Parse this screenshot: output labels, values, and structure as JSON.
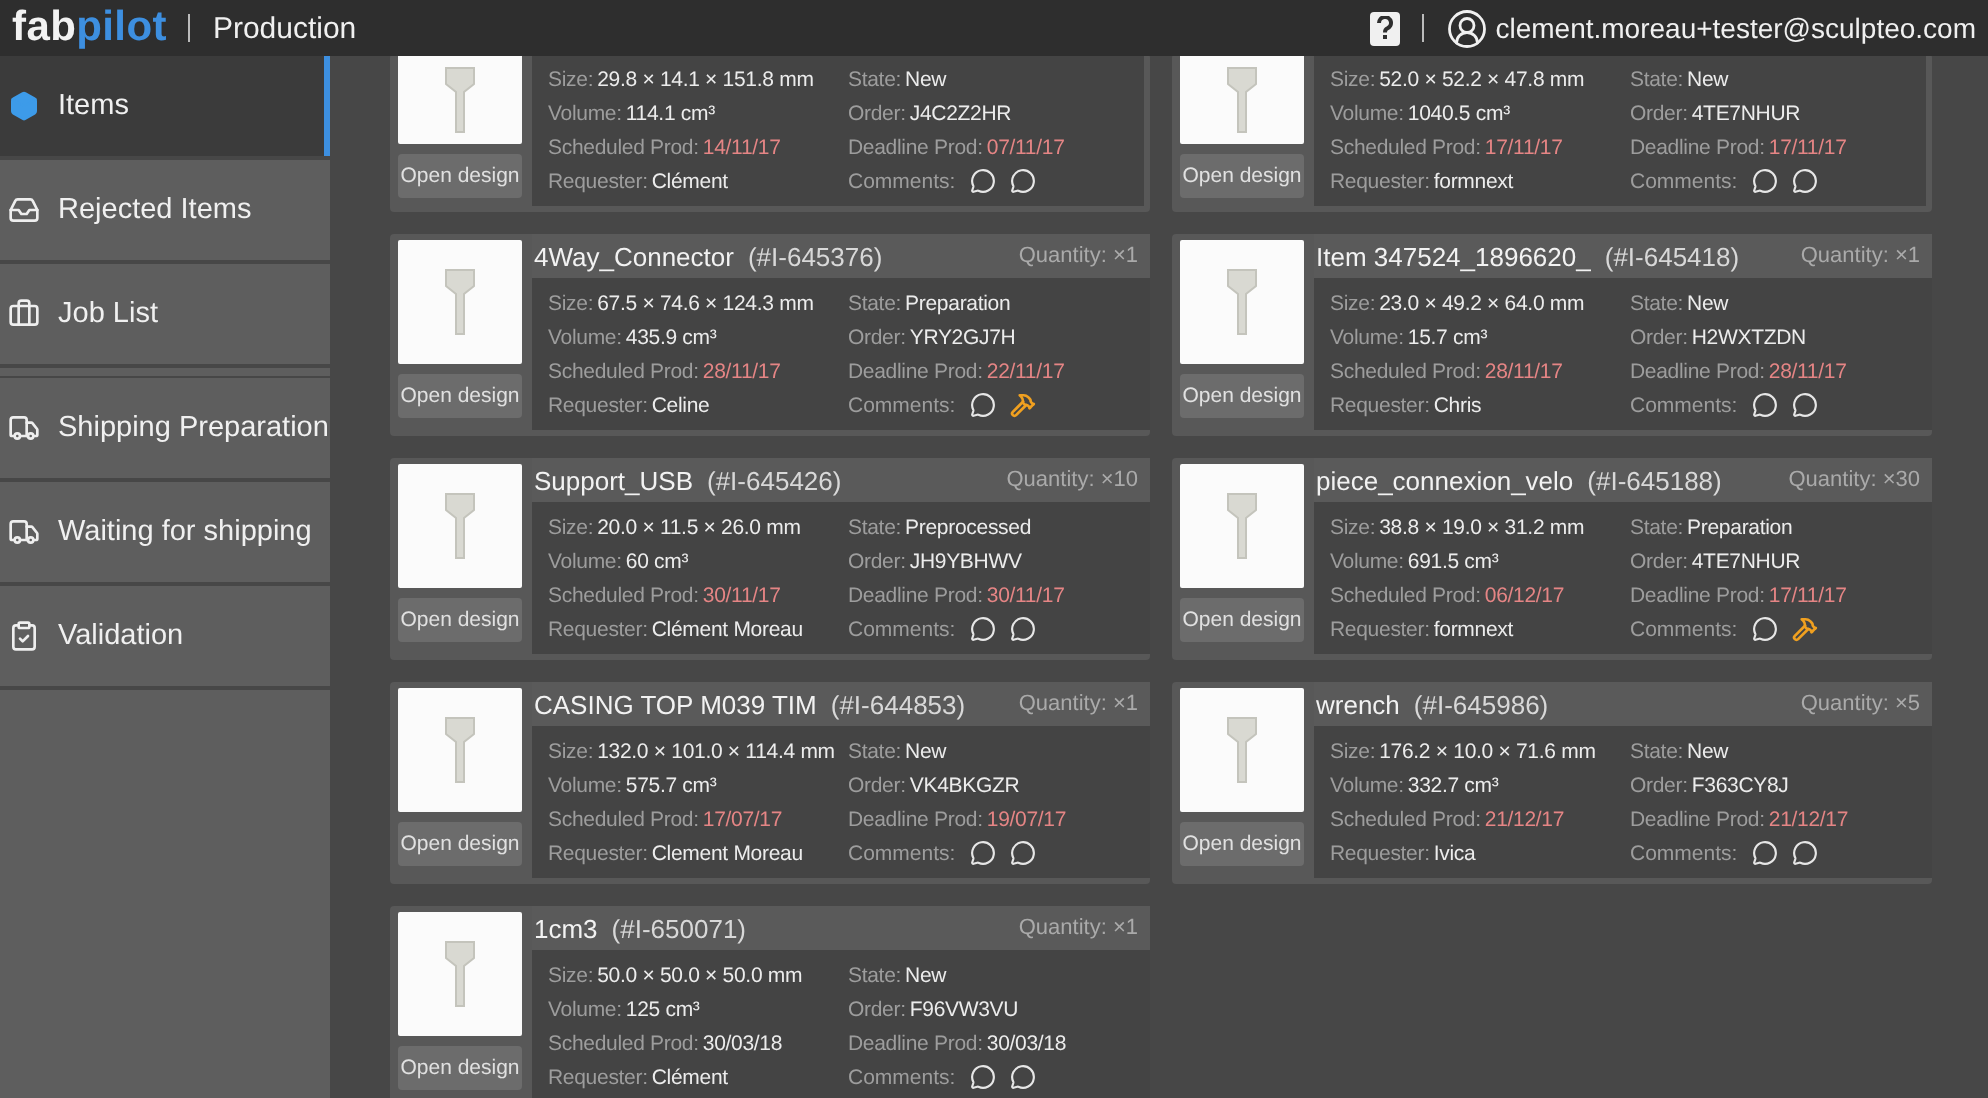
{
  "header": {
    "logo": {
      "text": "fab",
      "accent": "pilot"
    },
    "section": "Production",
    "user": "clement.moreau+tester@sculpteo.com"
  },
  "sidebar": {
    "items": [
      {
        "label": "Items",
        "selected": true
      },
      {
        "label": "Rejected Items",
        "selected": false
      },
      {
        "label": "Job List",
        "selected": false
      },
      {
        "label": "Shipping Preparation",
        "selected": false
      },
      {
        "label": "Waiting for shipping",
        "selected": false
      },
      {
        "label": "Validation",
        "selected": false
      }
    ]
  },
  "items": [
    {
      "button": "Open design",
      "details": [
        {
          "label": "Size:",
          "value": "29.8 × 14.1 × 151.8 mm",
          "alert": false
        },
        {
          "label": "State:",
          "value": "New",
          "alert": false
        },
        {
          "label": "Volume:",
          "value": "114.1 cm³",
          "alert": false
        },
        {
          "label": "Order:",
          "value": "J4C2Z2HR",
          "alert": false
        },
        {
          "label": "Scheduled Prod:",
          "value": "14/11/17",
          "alert": true
        },
        {
          "label": "Deadline Prod:",
          "value": "07/11/17",
          "alert": true
        },
        {
          "label": "Requester:",
          "value": "Clément",
          "alert": false
        }
      ],
      "comments_label": "Comments:",
      "comments": [
        {
          "kind": "comment"
        },
        {
          "kind": "comment"
        }
      ]
    },
    {
      "button": "Open design",
      "details": [
        {
          "label": "Size:",
          "value": "52.0 × 52.2 × 47.8 mm",
          "alert": false
        },
        {
          "label": "State:",
          "value": "New",
          "alert": false
        },
        {
          "label": "Volume:",
          "value": "1040.5 cm³",
          "alert": false
        },
        {
          "label": "Order:",
          "value": "4TE7NHUR",
          "alert": false
        },
        {
          "label": "Scheduled Prod:",
          "value": "17/11/17",
          "alert": true
        },
        {
          "label": "Deadline Prod:",
          "value": "17/11/17",
          "alert": true
        },
        {
          "label": "Requester:",
          "value": "formnext",
          "alert": false
        }
      ],
      "comments_label": "Comments:",
      "comments": [
        {
          "kind": "comment"
        },
        {
          "kind": "comment"
        }
      ]
    },
    {
      "name": "4Way_Connector",
      "id": "(#I-645376)",
      "quantity": "Quantity: ×1",
      "button": "Open design",
      "details": [
        {
          "label": "Size:",
          "value": "67.5 × 74.6 × 124.3 mm",
          "alert": false
        },
        {
          "label": "State:",
          "value": "Preparation",
          "alert": false
        },
        {
          "label": "Volume:",
          "value": "435.9 cm³",
          "alert": false
        },
        {
          "label": "Order:",
          "value": "YRY2GJ7H",
          "alert": false
        },
        {
          "label": "Scheduled Prod:",
          "value": "28/11/17",
          "alert": true
        },
        {
          "label": "Deadline Prod:",
          "value": "22/11/17",
          "alert": true
        },
        {
          "label": "Requester:",
          "value": "Celine",
          "alert": false
        }
      ],
      "comments_label": "Comments:",
      "comments": [
        {
          "kind": "comment"
        },
        {
          "kind": "hammer"
        }
      ]
    },
    {
      "name": "Item 347524_1896620_",
      "id": "(#I-645418)",
      "quantity": "Quantity: ×1",
      "button": "Open design",
      "details": [
        {
          "label": "Size:",
          "value": "23.0 × 49.2 × 64.0 mm",
          "alert": false
        },
        {
          "label": "State:",
          "value": "New",
          "alert": false
        },
        {
          "label": "Volume:",
          "value": "15.7 cm³",
          "alert": false
        },
        {
          "label": "Order:",
          "value": "H2WXTZDN",
          "alert": false
        },
        {
          "label": "Scheduled Prod:",
          "value": "28/11/17",
          "alert": true
        },
        {
          "label": "Deadline Prod:",
          "value": "28/11/17",
          "alert": true
        },
        {
          "label": "Requester:",
          "value": "Chris",
          "alert": false
        }
      ],
      "comments_label": "Comments:",
      "comments": [
        {
          "kind": "comment"
        },
        {
          "kind": "comment"
        }
      ]
    },
    {
      "name": "Support_USB",
      "id": "(#I-645426)",
      "quantity": "Quantity: ×10",
      "button": "Open design",
      "details": [
        {
          "label": "Size:",
          "value": "20.0 × 11.5 × 26.0 mm",
          "alert": false
        },
        {
          "label": "State:",
          "value": "Preprocessed",
          "alert": false
        },
        {
          "label": "Volume:",
          "value": "60 cm³",
          "alert": false
        },
        {
          "label": "Order:",
          "value": "JH9YBHWV",
          "alert": false
        },
        {
          "label": "Scheduled Prod:",
          "value": "30/11/17",
          "alert": true
        },
        {
          "label": "Deadline Prod:",
          "value": "30/11/17",
          "alert": true
        },
        {
          "label": "Requester:",
          "value": "Clément Moreau",
          "alert": false
        }
      ],
      "comments_label": "Comments:",
      "comments": [
        {
          "kind": "comment"
        },
        {
          "kind": "comment"
        }
      ]
    },
    {
      "name": "piece_connexion_velo",
      "id": "(#I-645188)",
      "quantity": "Quantity: ×30",
      "button": "Open design",
      "details": [
        {
          "label": "Size:",
          "value": "38.8 × 19.0 × 31.2 mm",
          "alert": false
        },
        {
          "label": "State:",
          "value": "Preparation",
          "alert": false
        },
        {
          "label": "Volume:",
          "value": "691.5 cm³",
          "alert": false
        },
        {
          "label": "Order:",
          "value": "4TE7NHUR",
          "alert": false
        },
        {
          "label": "Scheduled Prod:",
          "value": "06/12/17",
          "alert": true
        },
        {
          "label": "Deadline Prod:",
          "value": "17/11/17",
          "alert": true
        },
        {
          "label": "Requester:",
          "value": "formnext",
          "alert": false
        }
      ],
      "comments_label": "Comments:",
      "comments": [
        {
          "kind": "comment"
        },
        {
          "kind": "hammer"
        }
      ]
    },
    {
      "name": "CASING TOP M039 TIM",
      "id": "(#I-644853)",
      "quantity": "Quantity: ×1",
      "button": "Open design",
      "details": [
        {
          "label": "Size:",
          "value": "132.0 × 101.0 × 114.4 mm",
          "alert": false
        },
        {
          "label": "State:",
          "value": "New",
          "alert": false
        },
        {
          "label": "Volume:",
          "value": "575.7 cm³",
          "alert": false
        },
        {
          "label": "Order:",
          "value": "VK4BKGZR",
          "alert": false
        },
        {
          "label": "Scheduled Prod:",
          "value": "17/07/17",
          "alert": true
        },
        {
          "label": "Deadline Prod:",
          "value": "19/07/17",
          "alert": true
        },
        {
          "label": "Requester:",
          "value": "Clement Moreau",
          "alert": false
        }
      ],
      "comments_label": "Comments:",
      "comments": [
        {
          "kind": "comment"
        },
        {
          "kind": "comment"
        }
      ]
    },
    {
      "name": "wrench",
      "id": "(#I-645986)",
      "quantity": "Quantity: ×5",
      "button": "Open design",
      "details": [
        {
          "label": "Size:",
          "value": "176.2 × 10.0 × 71.6 mm",
          "alert": false
        },
        {
          "label": "State:",
          "value": "New",
          "alert": false
        },
        {
          "label": "Volume:",
          "value": "332.7 cm³",
          "alert": false
        },
        {
          "label": "Order:",
          "value": "F363CY8J",
          "alert": false
        },
        {
          "label": "Scheduled Prod:",
          "value": "21/12/17",
          "alert": true
        },
        {
          "label": "Deadline Prod:",
          "value": "21/12/17",
          "alert": true
        },
        {
          "label": "Requester:",
          "value": "Ivica",
          "alert": false
        }
      ],
      "comments_label": "Comments:",
      "comments": [
        {
          "kind": "comment"
        },
        {
          "kind": "comment"
        }
      ]
    },
    {
      "name": "1cm3",
      "id": "(#I-650071)",
      "quantity": "Quantity: ×1",
      "button": "Open design",
      "details": [
        {
          "label": "Size:",
          "value": "50.0 × 50.0 × 50.0 mm",
          "alert": false
        },
        {
          "label": "State:",
          "value": "New",
          "alert": false
        },
        {
          "label": "Volume:",
          "value": "125 cm³",
          "alert": false
        },
        {
          "label": "Order:",
          "value": "F96VW3VU",
          "alert": false
        },
        {
          "label": "Scheduled Prod:",
          "value": "30/03/18",
          "alert": false
        },
        {
          "label": "Deadline Prod:",
          "value": "30/03/18",
          "alert": false
        },
        {
          "label": "Requester:",
          "value": "Clément",
          "alert": false
        }
      ],
      "comments_label": "Comments:",
      "comments": [
        {
          "kind": "comment"
        },
        {
          "kind": "comment"
        }
      ]
    }
  ]
}
